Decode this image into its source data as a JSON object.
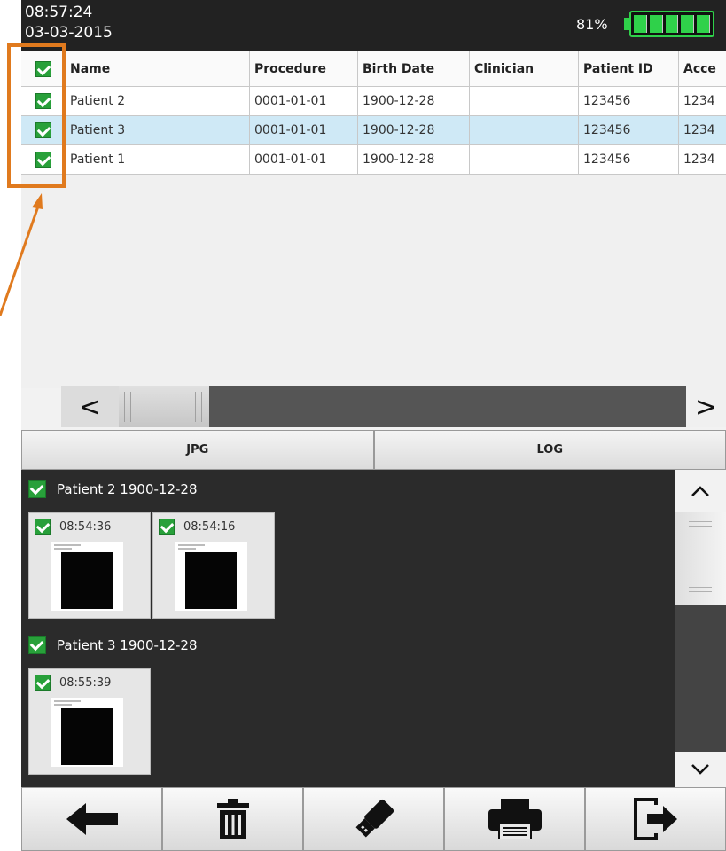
{
  "status": {
    "time": "08:57:24",
    "date": "03-03-2015",
    "battery_pct": "81%"
  },
  "table": {
    "columns": [
      "Name",
      "Procedure",
      "Birth Date",
      "Clinician",
      "Patient ID",
      "Acce"
    ],
    "rows": [
      {
        "name": "Patient 2",
        "procedure": "0001-01-01",
        "birth_date": "1900-12-28",
        "clinician": "",
        "patient_id": "123456",
        "acc": "1234",
        "checked": true,
        "selected": false
      },
      {
        "name": "Patient 3",
        "procedure": "0001-01-01",
        "birth_date": "1900-12-28",
        "clinician": "",
        "patient_id": "123456",
        "acc": "1234",
        "checked": true,
        "selected": true
      },
      {
        "name": "Patient 1",
        "procedure": "0001-01-01",
        "birth_date": "1900-12-28",
        "clinician": "",
        "patient_id": "123456",
        "acc": "1234",
        "checked": true,
        "selected": false
      }
    ]
  },
  "scroll": {
    "left": "<",
    "right": ">",
    "up": "^",
    "down": "v"
  },
  "tabs": {
    "jpg": "JPG",
    "log": "LOG"
  },
  "gallery": {
    "groups": [
      {
        "title": "Patient 2  1900-12-28",
        "items": [
          "08:54:36",
          "08:54:16"
        ]
      },
      {
        "title": "Patient 3  1900-12-28",
        "items": [
          "08:55:39"
        ]
      }
    ]
  },
  "toolbar": {
    "icons": [
      "back-arrow-icon",
      "trash-icon",
      "usb-drive-icon",
      "printer-icon",
      "export-icon"
    ]
  },
  "colors": {
    "annotation": "#e07a1e",
    "checkbox": "#28a03a",
    "selected_row": "#cfe9f6",
    "battery": "#2fd14a"
  }
}
